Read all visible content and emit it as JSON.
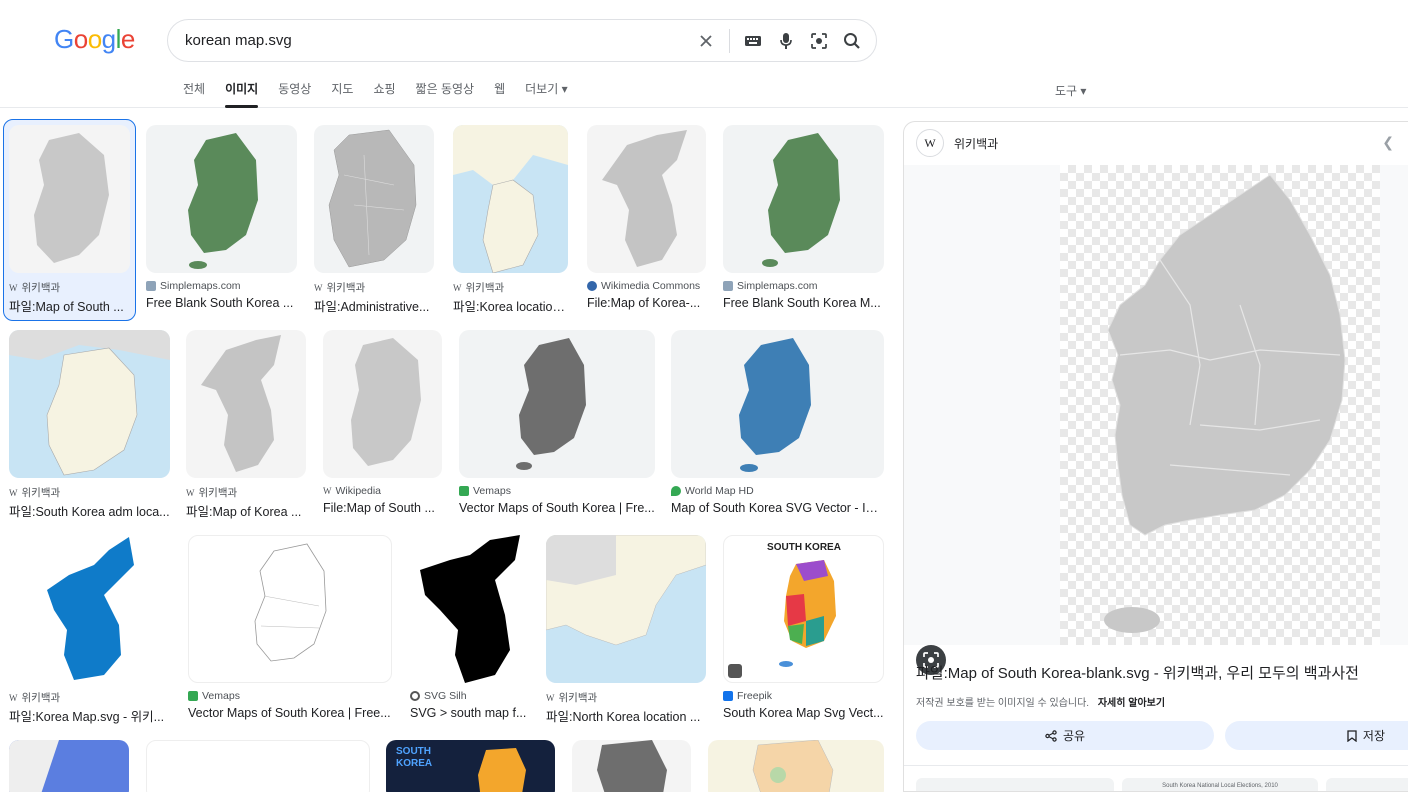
{
  "logo": {
    "letters": [
      "G",
      "o",
      "o",
      "g",
      "l",
      "e"
    ],
    "colors": [
      "#4285F4",
      "#EA4335",
      "#FBBC05",
      "#4285F4",
      "#34A853",
      "#EA4335"
    ]
  },
  "search": {
    "query": "korean map.svg"
  },
  "tabs": [
    {
      "label": "전체"
    },
    {
      "label": "이미지"
    },
    {
      "label": "동영상"
    },
    {
      "label": "지도"
    },
    {
      "label": "쇼핑"
    },
    {
      "label": "짧은 동영상"
    },
    {
      "label": "웹"
    },
    {
      "label": "더보기 ▾"
    }
  ],
  "tools_label": "도구 ▾",
  "results": {
    "row1": [
      {
        "source": "위키백과",
        "title": "파일:Map of South ..."
      },
      {
        "source": "Simplemaps.com",
        "title": "Free Blank South Korea ..."
      },
      {
        "source": "위키백과",
        "title": "파일:Administrative..."
      },
      {
        "source": "위키백과",
        "title": "파일:Korea location..."
      },
      {
        "source": "Wikimedia Commons",
        "title": "File:Map of Korea-..."
      },
      {
        "source": "Simplemaps.com",
        "title": "Free Blank South Korea M..."
      }
    ],
    "row2": [
      {
        "source": "위키백과",
        "title": "파일:South Korea adm loca..."
      },
      {
        "source": "위키백과",
        "title": "파일:Map of Korea ..."
      },
      {
        "source": "Wikipedia",
        "title": "File:Map of South ..."
      },
      {
        "source": "Vemaps",
        "title": "Vector Maps of South Korea | Fre..."
      },
      {
        "source": "World Map HD",
        "title": "Map of South Korea SVG Vector - Int..."
      }
    ],
    "row3": [
      {
        "source": "위키백과",
        "title": "파일:Korea Map.svg - 위키..."
      },
      {
        "source": "Vemaps",
        "title": "Vector Maps of South Korea | Free..."
      },
      {
        "source": "SVG Silh",
        "title": "SVG > south map f..."
      },
      {
        "source": "위키백과",
        "title": "파일:North Korea location ..."
      },
      {
        "source": "Freepik",
        "title": "South Korea Map Svg Vect..."
      }
    ],
    "thumb_text": {
      "south_korea": "SOUTH KOREA",
      "south": "SOUTH",
      "korea": "KOREA"
    }
  },
  "panel": {
    "source": "위키백과",
    "title": "파일:Map of South Korea-blank.svg - 위키백과, 우리 모두의 백과사전",
    "copyright_note": "저작권 보호를 받는 이미지일 수 있습니다.",
    "learn_more": "자세히 알아보기",
    "share_label": "공유",
    "save_label": "저장",
    "mini_caption": "South Korea National Local Elections, 2010"
  }
}
